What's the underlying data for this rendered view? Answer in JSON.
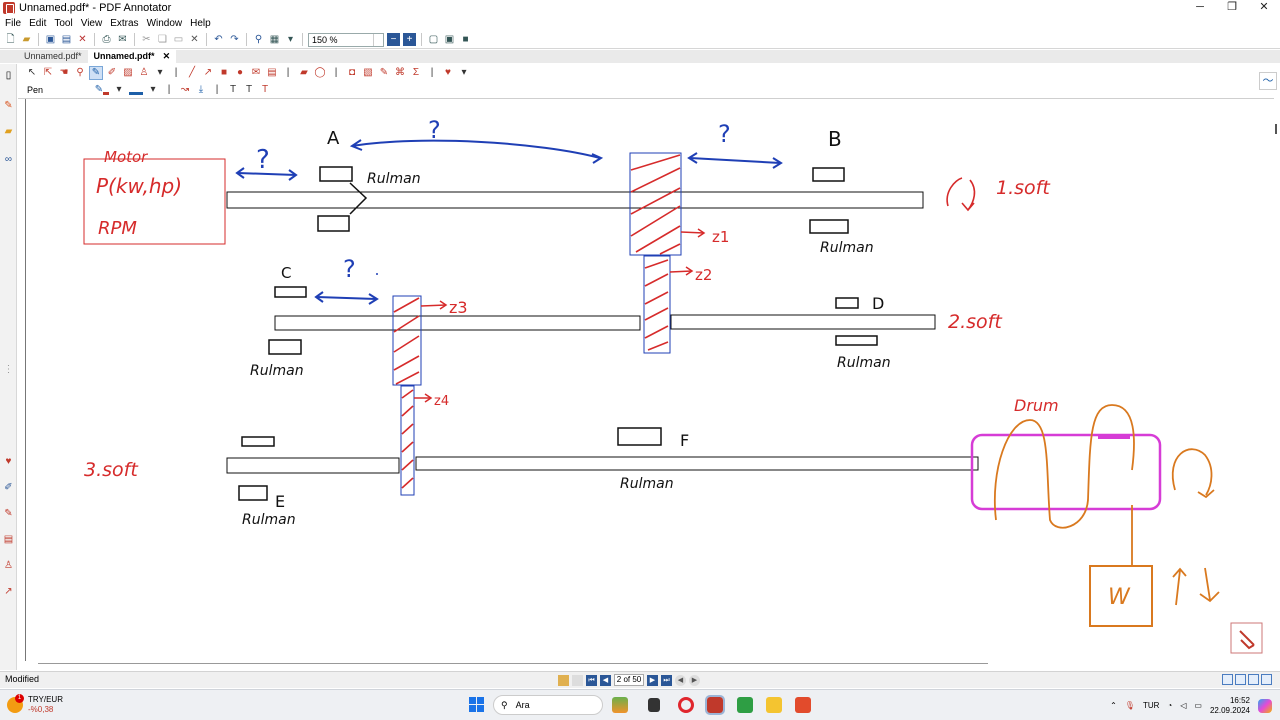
{
  "window": {
    "title": "Unnamed.pdf* - PDF Annotator",
    "controls": {
      "minimize": "─",
      "maximize": "❐",
      "close": "✕"
    }
  },
  "menu": [
    "File",
    "Edit",
    "Tool",
    "View",
    "Extras",
    "Window",
    "Help"
  ],
  "toolbar": {
    "zoom_value": "150 %"
  },
  "tabs": [
    {
      "label": "Unnamed.pdf*",
      "active": false
    },
    {
      "label": "Unnamed.pdf*",
      "active": true,
      "close": "✕"
    }
  ],
  "annotation_toolbar": {
    "current_tool": "Pen"
  },
  "drawing": {
    "motor_title": "Motor",
    "motor_power": "P(kw,hp)",
    "motor_rpm": "RPM",
    "label_a": "A",
    "label_b": "B",
    "label_c": "C",
    "label_d": "D",
    "label_e": "E",
    "label_f": "F",
    "question": "?",
    "question_blue_top": "?",
    "question_blue_ab": "?",
    "question_blue_c": "?",
    "rulman_a": "Rulman",
    "rulman_b": "Rulman",
    "rulman_c": "Rulman",
    "rulman_d": "Rulman",
    "rulman_e": "Rulman",
    "rulman_f": "Rulman",
    "z1": "z1",
    "z2": "z2",
    "z3": "z3",
    "z4": "z4",
    "shaft1": "1.soft",
    "shaft2": "2.soft",
    "shaft3": "3.soft",
    "drum": "Drum",
    "weight": "W",
    "colors": {
      "red": "#d62b2b",
      "blue": "#1f3fb5",
      "magenta": "#d63cd6",
      "orange": "#d9791f",
      "black": "#111111"
    }
  },
  "status": {
    "text": "Modified",
    "page": "2 of 50"
  },
  "taskbar": {
    "ticker_symbol": "TRY/EUR",
    "ticker_change": "-%0,38",
    "ticker_badge": "1",
    "search_placeholder": "Ara",
    "language": "TUR",
    "time": "16:52",
    "date": "22.09.2024"
  }
}
